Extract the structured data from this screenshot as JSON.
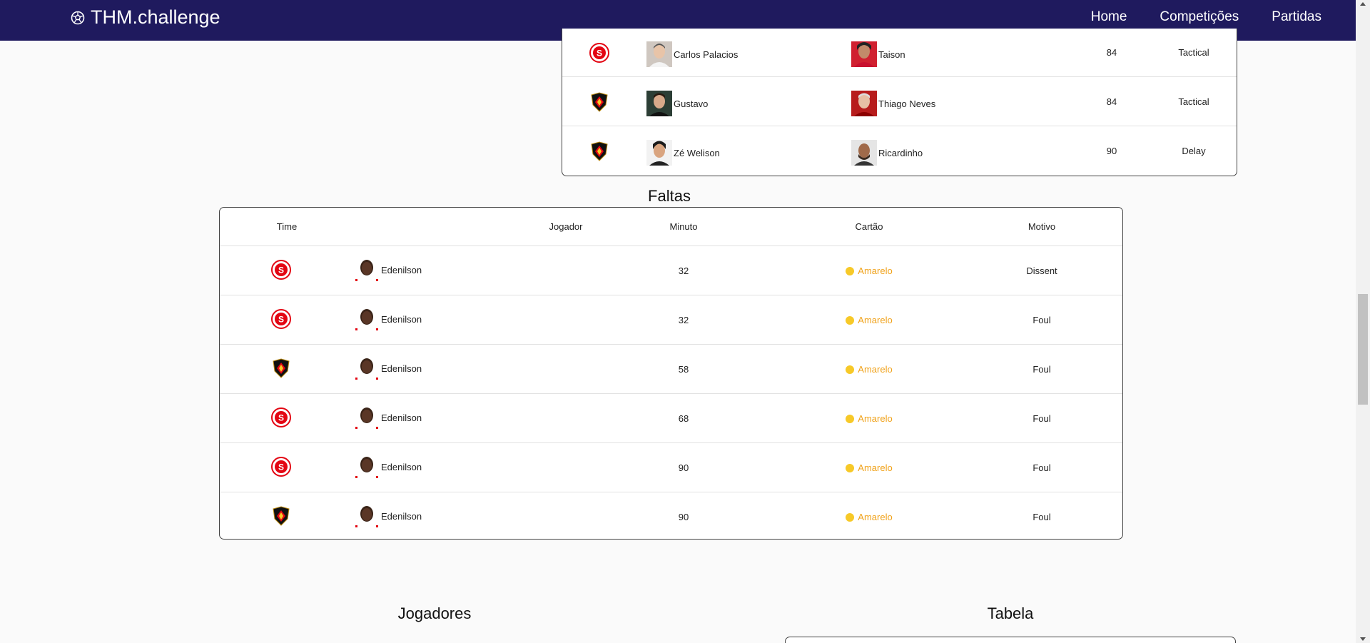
{
  "navbar": {
    "brand": "THM.challenge",
    "links": [
      "Home",
      "Competições",
      "Partidas"
    ]
  },
  "substitutions": {
    "rows": [
      {
        "team": "internacional",
        "player_out": "Carlos Palacios",
        "player_in": "Taison",
        "minute": "84",
        "reason": "Tactical"
      },
      {
        "team": "sport",
        "player_out": "Gustavo",
        "player_in": "Thiago Neves",
        "minute": "84",
        "reason": "Tactical"
      },
      {
        "team": "sport",
        "player_out": "Zé Welison",
        "player_in": "Ricardinho",
        "minute": "90",
        "reason": "Delay"
      }
    ]
  },
  "faltas": {
    "title": "Faltas",
    "headers": {
      "team": "Time",
      "player": "Jogador",
      "minute": "Minuto",
      "card": "Cartão",
      "reason": "Motivo"
    },
    "rows": [
      {
        "team": "internacional",
        "player": "Edenilson",
        "minute": "32",
        "card": "Amarelo",
        "reason": "Dissent"
      },
      {
        "team": "internacional",
        "player": "Edenilson",
        "minute": "32",
        "card": "Amarelo",
        "reason": "Foul"
      },
      {
        "team": "sport",
        "player": "Edenilson",
        "minute": "58",
        "card": "Amarelo",
        "reason": "Foul"
      },
      {
        "team": "internacional",
        "player": "Edenilson",
        "minute": "68",
        "card": "Amarelo",
        "reason": "Foul"
      },
      {
        "team": "internacional",
        "player": "Edenilson",
        "minute": "90",
        "card": "Amarelo",
        "reason": "Foul"
      },
      {
        "team": "sport",
        "player": "Edenilson",
        "minute": "90",
        "card": "Amarelo",
        "reason": "Foul"
      }
    ]
  },
  "sections": {
    "jogadores": "Jogadores",
    "tabela": "Tabela"
  },
  "colors": {
    "navbar": "#1f1a5e",
    "card_yellow": "#f7c928",
    "card_text": "#f0a21a"
  }
}
